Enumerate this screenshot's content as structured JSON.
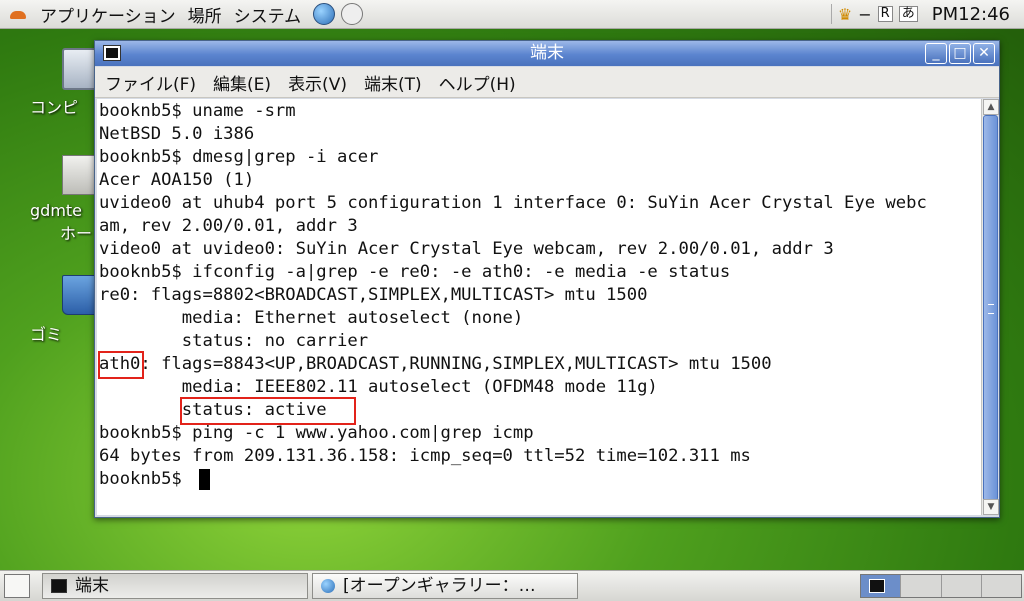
{
  "top_panel": {
    "menus": [
      "アプリケーション",
      "場所",
      "システム"
    ],
    "clock": "PM12:46",
    "tray": [
      "R"
    ]
  },
  "desktop": {
    "icons": [
      {
        "label": "コンピ"
      },
      {
        "label": "gdmte"
      },
      {
        "label": "ホー"
      },
      {
        "label": "ゴミ"
      }
    ]
  },
  "window": {
    "title": "端末",
    "menus": [
      "ファイル(F)",
      "編集(E)",
      "表示(V)",
      "端末(T)",
      "ヘルプ(H)"
    ],
    "lines": [
      "booknb5$ uname -srm",
      "NetBSD 5.0 i386",
      "booknb5$ dmesg|grep -i acer",
      "Acer AOA150 (1)",
      "uvideo0 at uhub4 port 5 configuration 1 interface 0: SuYin Acer Crystal Eye webc",
      "am, rev 2.00/0.01, addr 3",
      "video0 at uvideo0: SuYin Acer Crystal Eye webcam, rev 2.00/0.01, addr 3",
      "booknb5$ ifconfig -a|grep -e re0: -e ath0: -e media -e status",
      "re0: flags=8802<BROADCAST,SIMPLEX,MULTICAST> mtu 1500",
      "        media: Ethernet autoselect (none)",
      "        status: no carrier",
      "ath0: flags=8843<UP,BROADCAST,RUNNING,SIMPLEX,MULTICAST> mtu 1500",
      "        media: IEEE802.11 autoselect (OFDM48 mode 11g)",
      "        status: active",
      "booknb5$ ping -c 1 www.yahoo.com|grep icmp",
      "64 bytes from 209.131.36.158: icmp_seq=0 ttl=52 time=102.311 ms",
      "booknb5$ "
    ]
  },
  "taskbar": {
    "tasks": [
      {
        "label": "端末"
      },
      {
        "label": "[オープンギャラリー：…"
      }
    ]
  }
}
